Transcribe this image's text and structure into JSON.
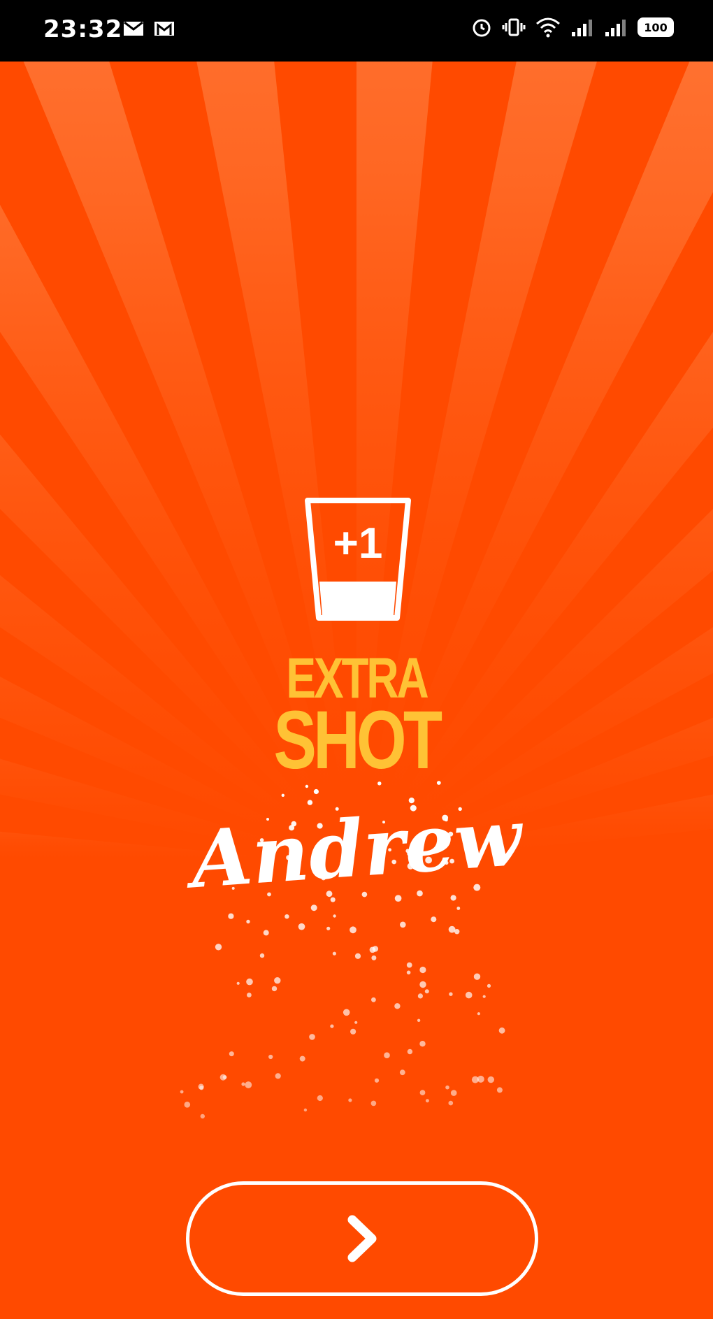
{
  "status_bar": {
    "time": "23:32",
    "battery_level": "100",
    "icons_left": [
      "mail-icon",
      "gmail-icon"
    ],
    "icons_right": [
      "alarm-icon",
      "vibrate-icon",
      "wifi-icon",
      "signal-icon",
      "signal-icon",
      "battery-icon"
    ]
  },
  "theme": {
    "background": "#FF4A00",
    "ray_color": "#FF8A4D",
    "brand_color": "#FFC235",
    "text_color": "#FFFFFF"
  },
  "logo": {
    "badge_text": "+1",
    "line1": "EXTRA",
    "line2": "SHOT"
  },
  "greeting": {
    "name": "Andrew"
  },
  "next_button": {
    "icon": "chevron-right-icon",
    "glyph": "›"
  }
}
